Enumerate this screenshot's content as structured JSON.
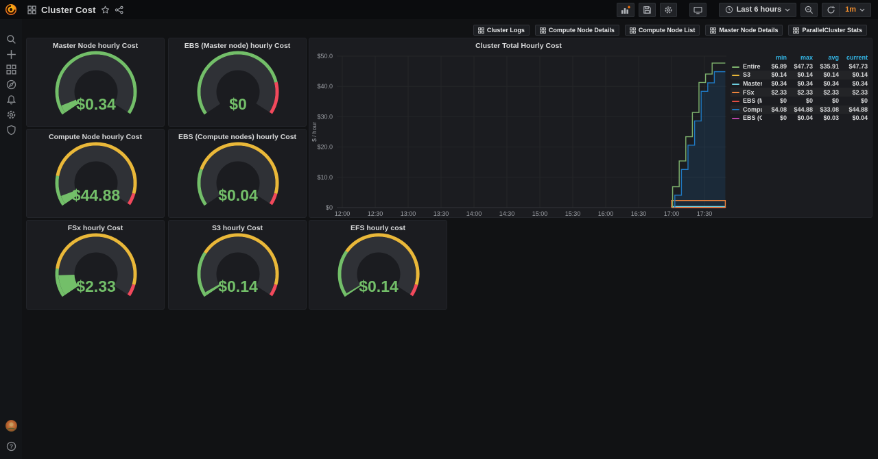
{
  "navbar": {
    "title": "Cluster Cost",
    "left_icons": [
      "grafana-logo",
      "dashboard-grid-icon",
      "star-icon",
      "share-icon"
    ],
    "toolbar_icons": [
      "add-panel-icon",
      "save-dashboard-icon",
      "dashboard-settings-icon",
      "cycle-view-mode-icon",
      "clock-icon",
      "zoom-out-icon",
      "refresh-icon",
      "caret-down-icon"
    ],
    "time_range_label": "Last 6 hours",
    "refresh_interval_label": "1m"
  },
  "sidebar": {
    "top_icons": [
      "search-icon",
      "plus-icon",
      "dashboards-icon",
      "explore-compass-icon",
      "alerting-bell-icon",
      "configuration-gear-icon",
      "server-admin-shield-icon"
    ],
    "bottom_icons": [
      "user-avatar",
      "help-icon"
    ]
  },
  "submenu": {
    "links": [
      "Cluster Logs",
      "Compute Node Details",
      "Compute Node List",
      "Master Node Details",
      "ParallelCluster Stats"
    ]
  },
  "colors": {
    "gauge_green": "#73BF69",
    "gauge_yellow": "#EAB839",
    "gauge_red": "#F2495C",
    "gauge_body": "#2f3136",
    "legend_header_blue": "#33b5e5",
    "accent_orange": "#ff780a"
  },
  "gauges": [
    {
      "title": "Master Node hourly Cost",
      "value": "$0.34",
      "fill_fraction": 0.05,
      "segments": [
        [
          "green",
          1.0
        ]
      ]
    },
    {
      "title": "EBS (Master node) hourly Cost",
      "value": "$0",
      "fill_fraction": 0.0,
      "segments": [
        [
          "green",
          0.81
        ],
        [
          "red",
          0.19
        ]
      ]
    },
    {
      "title": "Compute Node hourly Cost",
      "value": "$44.88",
      "fill_fraction": 0.055,
      "segments": [
        [
          "green",
          0.18
        ],
        [
          "yellow",
          0.75
        ],
        [
          "red",
          0.07
        ]
      ]
    },
    {
      "title": "EBS (Compute nodes) hourly Cost",
      "value": "$0.04",
      "fill_fraction": 0.0,
      "segments": [
        [
          "green",
          0.22
        ],
        [
          "yellow",
          0.71
        ],
        [
          "red",
          0.07
        ]
      ]
    },
    {
      "title": "FSx hourly Cost",
      "value": "$2.33",
      "fill_fraction": 0.13,
      "segments": [
        [
          "green",
          0.17
        ],
        [
          "yellow",
          0.76
        ],
        [
          "red",
          0.07
        ]
      ]
    },
    {
      "title": "S3 hourly Cost",
      "value": "$0.14",
      "fill_fraction": 0.02,
      "segments": [
        [
          "green",
          0.27
        ],
        [
          "yellow",
          0.66
        ],
        [
          "red",
          0.07
        ]
      ]
    },
    {
      "title": "EFS hourly cost",
      "value": "$0.14",
      "fill_fraction": 0.012,
      "segments": [
        [
          "green",
          0.28
        ],
        [
          "yellow",
          0.65
        ],
        [
          "red",
          0.07
        ]
      ]
    }
  ],
  "chart_data": {
    "type": "line",
    "title": "Cluster Total Hourly Cost",
    "ylabel": "$ / hour",
    "ylim": [
      0,
      50
    ],
    "y_ticks": [
      "$50.0",
      "$40.0",
      "$30.0",
      "$20.0",
      "$10.0",
      "$0"
    ],
    "y_tick_values": [
      50,
      40,
      30,
      20,
      10,
      0
    ],
    "x_ticks": [
      "12:00",
      "12:30",
      "13:00",
      "13:30",
      "14:00",
      "14:30",
      "15:00",
      "15:30",
      "16:00",
      "16:30",
      "17:00",
      "17:30"
    ],
    "x_tick_minutes": [
      720,
      750,
      780,
      810,
      840,
      870,
      900,
      930,
      960,
      990,
      1020,
      1050
    ],
    "x_range_minutes": [
      715,
      1070
    ],
    "grid": true,
    "legend_position": "right-table",
    "legend_columns": [
      "min",
      "max",
      "avg",
      "current"
    ],
    "series": [
      {
        "name": "Entire Cluster cost",
        "color": "#7EB26D",
        "z": 7,
        "stats": {
          "min": "$6.89",
          "max": "$47.73",
          "avg": "$35.91",
          "current": "$47.73"
        },
        "points": [
          [
            1021,
            0
          ],
          [
            1021,
            6.89
          ],
          [
            1027,
            6.89
          ],
          [
            1027,
            15.4
          ],
          [
            1033,
            15.4
          ],
          [
            1033,
            23.4
          ],
          [
            1039,
            23.4
          ],
          [
            1039,
            31.4
          ],
          [
            1045,
            31.4
          ],
          [
            1045,
            41.3
          ],
          [
            1051,
            41.3
          ],
          [
            1051,
            44.1
          ],
          [
            1057,
            44.1
          ],
          [
            1057,
            47.73
          ],
          [
            1069,
            47.73
          ]
        ]
      },
      {
        "name": "S3",
        "color": "#EAB839",
        "z": 3,
        "stats": {
          "min": "$0.14",
          "max": "$0.14",
          "avg": "$0.14",
          "current": "$0.14"
        },
        "points": [
          [
            1020,
            0.14
          ],
          [
            1069,
            0.14
          ]
        ]
      },
      {
        "name": "Master Node",
        "color": "#6ED0E0",
        "z": 4,
        "stats": {
          "min": "$0.34",
          "max": "$0.34",
          "avg": "$0.34",
          "current": "$0.34"
        },
        "points": [
          [
            1020,
            0.34
          ],
          [
            1069,
            0.34
          ]
        ]
      },
      {
        "name": "FSx",
        "color": "#EF843C",
        "z": 5,
        "stats": {
          "min": "$2.33",
          "max": "$2.33",
          "avg": "$2.33",
          "current": "$2.33"
        },
        "points": [
          [
            1020,
            0.07
          ],
          [
            1020,
            2.33
          ],
          [
            1069,
            2.33
          ],
          [
            1069,
            0.07
          ],
          [
            1020,
            0.07
          ]
        ]
      },
      {
        "name": "EBS (Master)",
        "color": "#E24D42",
        "z": 2,
        "stats": {
          "min": "$0",
          "max": "$0",
          "avg": "$0",
          "current": "$0"
        },
        "points": [
          [
            1020,
            0.02
          ],
          [
            1069,
            0.02
          ]
        ]
      },
      {
        "name": "Compute Nodes",
        "color": "#1F78C1",
        "z": 6,
        "fill": "rgba(31,120,193,0.16)",
        "stats": {
          "min": "$4.08",
          "max": "$44.88",
          "avg": "$33.08",
          "current": "$44.88"
        },
        "points": [
          [
            1023,
            0
          ],
          [
            1023,
            4.08
          ],
          [
            1029,
            4.08
          ],
          [
            1029,
            12.6
          ],
          [
            1035,
            12.6
          ],
          [
            1035,
            20.6
          ],
          [
            1041,
            20.6
          ],
          [
            1041,
            28.6
          ],
          [
            1047,
            28.6
          ],
          [
            1047,
            38.4
          ],
          [
            1053,
            38.4
          ],
          [
            1053,
            41.2
          ],
          [
            1059,
            41.2
          ],
          [
            1059,
            44.88
          ],
          [
            1069,
            44.88
          ]
        ]
      },
      {
        "name": "EBS (Compute)",
        "color": "#BA43A9",
        "z": 1,
        "stats": {
          "min": "$0",
          "max": "$0.04",
          "avg": "$0.03",
          "current": "$0.04"
        },
        "points": [
          [
            1020,
            0
          ],
          [
            1069,
            0
          ]
        ]
      }
    ]
  }
}
